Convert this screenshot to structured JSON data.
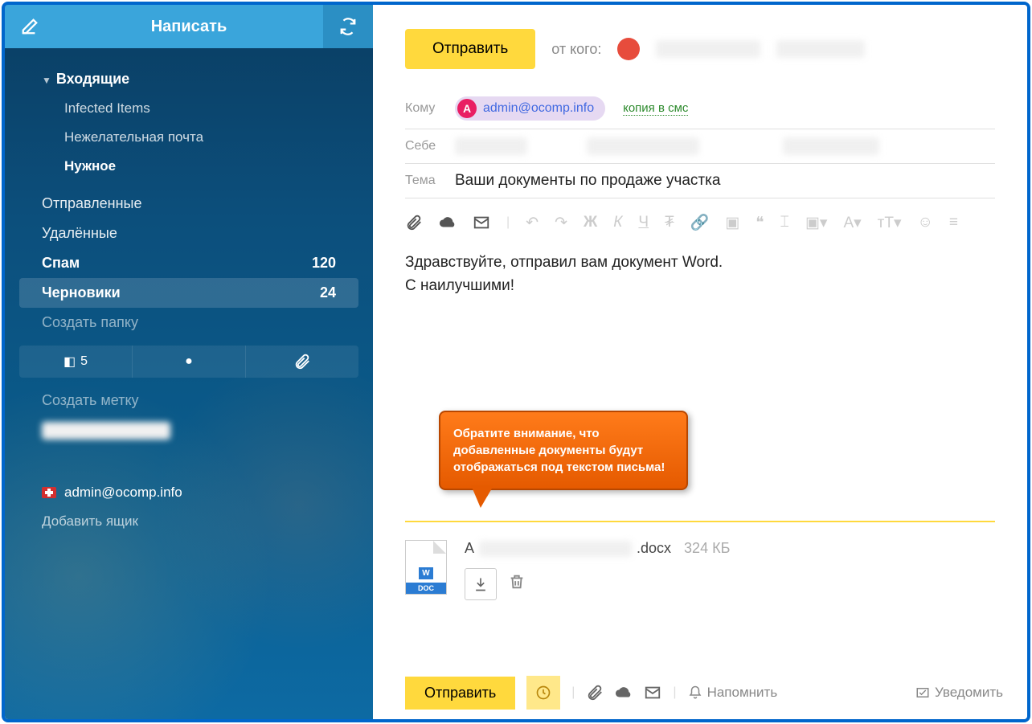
{
  "sidebar": {
    "compose_label": "Написать",
    "folders": {
      "inbox": "Входящие",
      "infected": "Infected Items",
      "junk": "Нежелательная почта",
      "needed": "Нужное",
      "sent": "Отправленные",
      "deleted": "Удалённые",
      "spam": "Спам",
      "spam_count": "120",
      "drafts": "Черновики",
      "drafts_count": "24",
      "create_folder": "Создать папку",
      "create_label": "Создать метку"
    },
    "flag_count": "5",
    "account_email": "admin@ocomp.info",
    "add_mailbox": "Добавить ящик"
  },
  "compose": {
    "send_label": "Отправить",
    "from_label": "от кого:",
    "to_label": "Кому",
    "self_label": "Себе",
    "subject_label": "Тема",
    "recipient_initial": "А",
    "recipient_email": "admin@ocomp.info",
    "sms_copy": "копия в смс",
    "subject_value": "Ваши документы по продаже участка",
    "body_line1": "Здравствуйте, отправил вам документ Word.",
    "body_line2": "С наилучшими!",
    "attachment": {
      "name_prefix": "А",
      "ext": ".docx",
      "size": "324 КБ",
      "icon_w": "W",
      "icon_type": "DOC"
    },
    "bottom_send": "Отправить",
    "remind": "Напомнить",
    "notify": "Уведомить"
  },
  "callout": {
    "text": "Обратите внимание, что добавленные документы будут отображаться под текстом письма!"
  }
}
